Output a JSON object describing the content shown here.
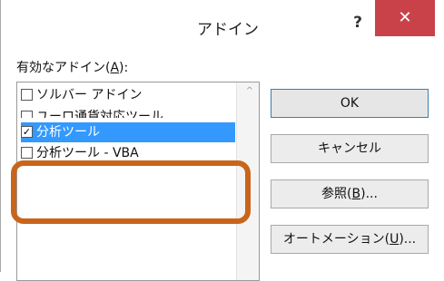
{
  "dialog": {
    "title": "アドイン",
    "help": "?",
    "close": "✕"
  },
  "list": {
    "label_prefix": "有効なアドイン(",
    "label_mnemonic": "A",
    "label_suffix": "):",
    "items": [
      {
        "label": "ソルバー アドイン",
        "checked": false
      },
      {
        "label": "ユーロ通貨対応ツール",
        "checked": false
      },
      {
        "label": "分析ツール",
        "checked": true
      },
      {
        "label": "分析ツール - VBA",
        "checked": false
      }
    ]
  },
  "buttons": {
    "ok": "OK",
    "cancel": "キャンセル",
    "browse_prefix": "参照(",
    "browse_mnemonic": "B",
    "browse_suffix": ")...",
    "automation_prefix": "オートメーション(",
    "automation_mnemonic": "U",
    "automation_suffix": ")..."
  },
  "colors": {
    "selection": "#3399ff",
    "highlight_outline": "#c9651a",
    "close_button": "#c9424a"
  },
  "icons": {
    "check": "✓",
    "scroll_up": "^"
  }
}
